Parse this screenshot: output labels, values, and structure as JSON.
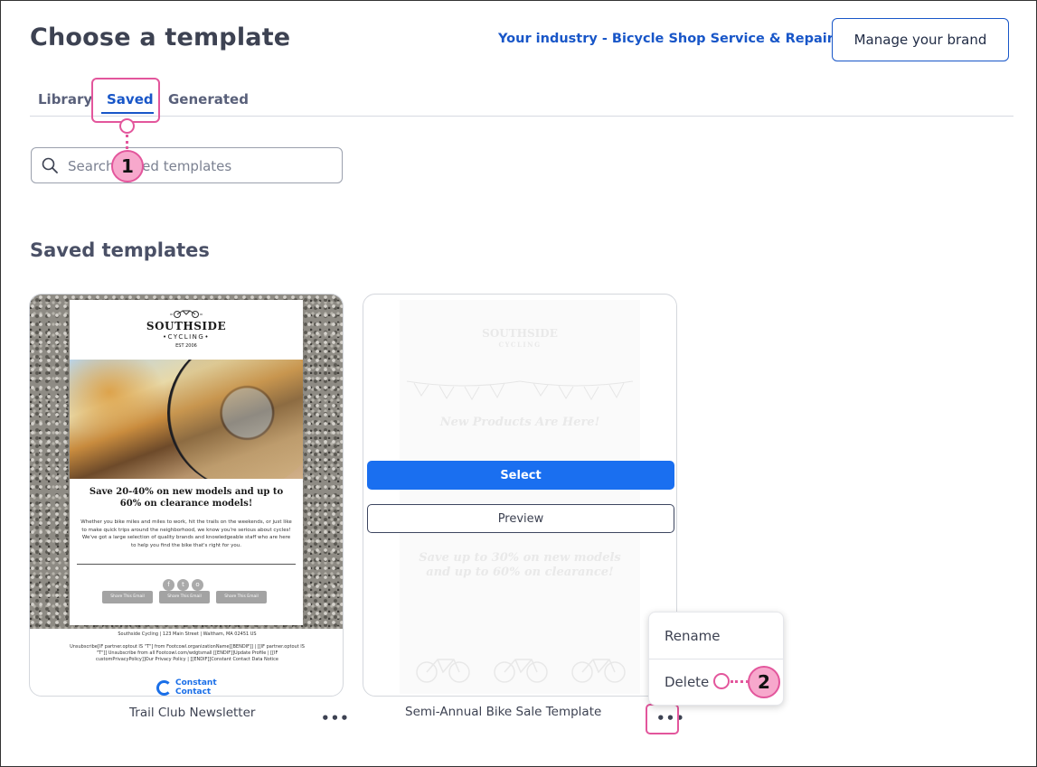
{
  "header": {
    "title": "Choose a template",
    "industry_link": "Your industry - Bicycle Shop Service & Repair",
    "brand_button": "Manage your brand"
  },
  "tabs": [
    {
      "label": "Library",
      "active": false
    },
    {
      "label": "Saved",
      "active": true
    },
    {
      "label": "Generated",
      "active": false
    }
  ],
  "search": {
    "placeholder": "Search saved templates",
    "value": ""
  },
  "section_title": "Saved templates",
  "cards": [
    {
      "name": "Trail Club Newsletter",
      "more_label": "•••",
      "email": {
        "logo_main": "SOUTHSIDE",
        "logo_sub": "•CYCLING•",
        "logo_est": "EST 2006",
        "headline": "Save 20-40% on new models and up to 60% on clearance models!",
        "body": "Whether you bike miles and miles to work, hit the trails on the weekends, or just like to make quick trips around the neighborhood, we know you're serious about cycles! We've got a large selection of quality brands and knowledgeable staff who are here to help you find the bike that's right for you.",
        "share_buttons": [
          "Share This Email",
          "Share This Email",
          "Share This Email"
        ],
        "footer_address": "Southside Cycling | 123 Main Street | Waltham, MA 02451 US",
        "footer_links": "Unsubscribe[IF partner.optout IS \"T\"] from Footcowl.organizationName[[BENDIF]] | [[IF partner.optout IS \"T\"]] Unsubscribe from all Footcowl.com/wdgtsmall [[ENDIF]]Update Profile | [[IF customPrivacyPolicy]]Our Privacy Policy | [[ENDIF]]Constant Contact Data Notice",
        "brand_line1": "Constant",
        "brand_line2": "Contact"
      }
    },
    {
      "name": "Semi-Annual Bike Sale Template",
      "more_label": "•••",
      "select_label": "Select",
      "preview_label": "Preview",
      "email": {
        "logo_main": "SOUTHSIDE",
        "logo_sub": "CYCLING",
        "headline": "New Products Are Here!",
        "sale_text": "Save up to 30% on new models and up to 60% on clearance!"
      }
    }
  ],
  "context_menu": {
    "items": [
      "Rename",
      "Delete"
    ]
  },
  "callouts": [
    "1",
    "2"
  ],
  "colors": {
    "accent": "#1856c8",
    "select_button": "#1a6ff0",
    "callout": "#e3569c",
    "callout_fill": "#f7a8cc"
  }
}
